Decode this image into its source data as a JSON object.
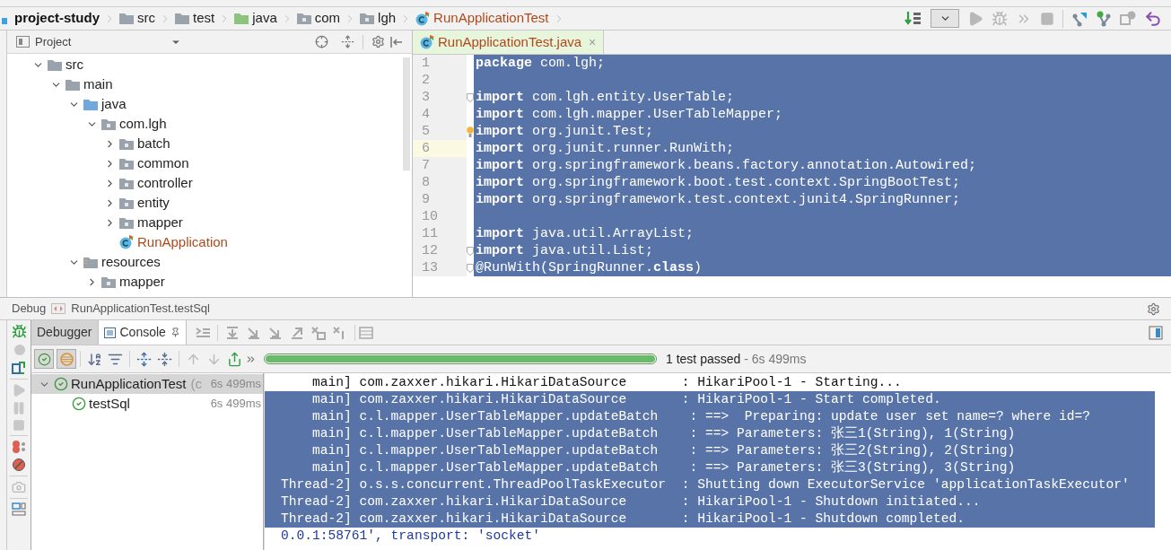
{
  "breadcrumbs": [
    {
      "label": "project-study",
      "kind": "project"
    },
    {
      "label": "src",
      "kind": "folder"
    },
    {
      "label": "test",
      "kind": "folder"
    },
    {
      "label": "java",
      "kind": "test-root"
    },
    {
      "label": "com",
      "kind": "package"
    },
    {
      "label": "lgh",
      "kind": "package"
    },
    {
      "label": "RunApplicationTest",
      "kind": "class"
    }
  ],
  "project_panel": {
    "title": "Project",
    "tree": [
      {
        "label": "src",
        "kind": "folder",
        "expanded": true,
        "children": [
          {
            "label": "main",
            "kind": "folder",
            "expanded": true,
            "children": [
              {
                "label": "java",
                "kind": "source-root",
                "expanded": true,
                "children": [
                  {
                    "label": "com.lgh",
                    "kind": "package",
                    "expanded": true,
                    "children": [
                      {
                        "label": "batch",
                        "kind": "package",
                        "expanded": false
                      },
                      {
                        "label": "common",
                        "kind": "package",
                        "expanded": false
                      },
                      {
                        "label": "controller",
                        "kind": "package",
                        "expanded": false
                      },
                      {
                        "label": "entity",
                        "kind": "package",
                        "expanded": false
                      },
                      {
                        "label": "mapper",
                        "kind": "package",
                        "expanded": false
                      },
                      {
                        "label": "RunApplication",
                        "kind": "class"
                      }
                    ]
                  }
                ]
              },
              {
                "label": "resources",
                "kind": "resources-root",
                "expanded": true,
                "children": [
                  {
                    "label": "mapper",
                    "kind": "package",
                    "expanded": false
                  }
                ]
              }
            ]
          }
        ]
      }
    ]
  },
  "editor": {
    "tabs": [
      {
        "label": "RunApplicationTest.java",
        "selected": true,
        "close": "×"
      }
    ],
    "lines": [
      {
        "number": "1",
        "text": "**package** com.lgh;",
        "selected": true,
        "current": false
      },
      {
        "number": "2",
        "selected": true,
        "current": false
      },
      {
        "number": "3",
        "text": "**import** com.lgh.entity.UserTable;",
        "selected": true,
        "current": false,
        "fold": true
      },
      {
        "number": "4",
        "text": "**import** com.lgh.mapper.UserTableMapper;",
        "selected": true,
        "current": false
      },
      {
        "number": "5",
        "text": "**import** org.junit.Test;",
        "selected": true,
        "current": false,
        "bulb": true
      },
      {
        "number": "6",
        "text": "**import** org.junit.runner.RunWith;",
        "selected": true,
        "current": true
      },
      {
        "number": "7",
        "text": "**import** org.springframework.beans.factory.annotation.Autowired;",
        "selected": true,
        "current": false
      },
      {
        "number": "8",
        "text": "**import** org.springframework.boot.test.context.SpringBootTest;",
        "selected": true,
        "current": false
      },
      {
        "number": "9",
        "text": "**import** org.springframework.test.context.junit4.SpringRunner;",
        "selected": true,
        "current": false
      },
      {
        "number": "10",
        "selected": true,
        "current": false
      },
      {
        "number": "11",
        "text": "**import** java.util.ArrayList;",
        "selected": true,
        "current": false
      },
      {
        "number": "12",
        "text": "**import** java.util.List;",
        "selected": true,
        "current": false,
        "fold": true
      },
      {
        "number": "13",
        "text": "@RunWith(SpringRunner.**class**)",
        "selected": true,
        "current": false,
        "fold": true
      }
    ]
  },
  "debug": {
    "label": "Debug",
    "config": "RunApplicationTest.testSql",
    "tabs": [
      {
        "label": "Debugger",
        "selected": false
      },
      {
        "label": "Console",
        "selected": true
      }
    ],
    "progress": {
      "level": 1,
      "status": "1 test passed",
      "time": " - 6s 499ms"
    },
    "tests": [
      {
        "name": "RunApplicationTest",
        "note": "(c",
        "time": "6s 499ms",
        "selected": true,
        "passed": true,
        "children": [
          {
            "name": "testSql",
            "time": "6s 499ms",
            "selected": false,
            "passed": true
          }
        ]
      }
    ],
    "console": [
      {
        "text": "    main] com.zaxxer.hikari.HikariDataSource       : HikariPool-1 - Starting...",
        "selected": false
      },
      {
        "text": "    main] com.zaxxer.hikari.HikariDataSource       : HikariPool-1 - Start completed.",
        "selected": true
      },
      {
        "text": "    main] c.l.mapper.UserTableMapper.updateBatch    : ==>  Preparing: update user set name=? where id=?",
        "selected": true
      },
      {
        "text": "    main] c.l.mapper.UserTableMapper.updateBatch    : ==> Parameters: 张三1(String), 1(String)",
        "selected": true
      },
      {
        "text": "    main] c.l.mapper.UserTableMapper.updateBatch    : ==> Parameters: 张三2(String), 2(String)",
        "selected": true
      },
      {
        "text": "    main] c.l.mapper.UserTableMapper.updateBatch    : ==> Parameters: 张三3(String), 3(String)",
        "selected": true
      },
      {
        "text": "Thread-2] o.s.s.concurrent.ThreadPoolTaskExecutor  : Shutting down ExecutorService 'applicationTaskExecutor'",
        "selected": true
      },
      {
        "text": "Thread-2] com.zaxxer.hikari.HikariDataSource       : HikariPool-1 - Shutdown initiated...",
        "selected": true
      },
      {
        "text": "Thread-2] com.zaxxer.hikari.HikariDataSource       : HikariPool-1 - Shutdown completed.",
        "selected": true
      },
      {
        "text": "0.0.1:58761', transport: 'socket'",
        "selected": false,
        "kind": "system"
      }
    ]
  }
}
